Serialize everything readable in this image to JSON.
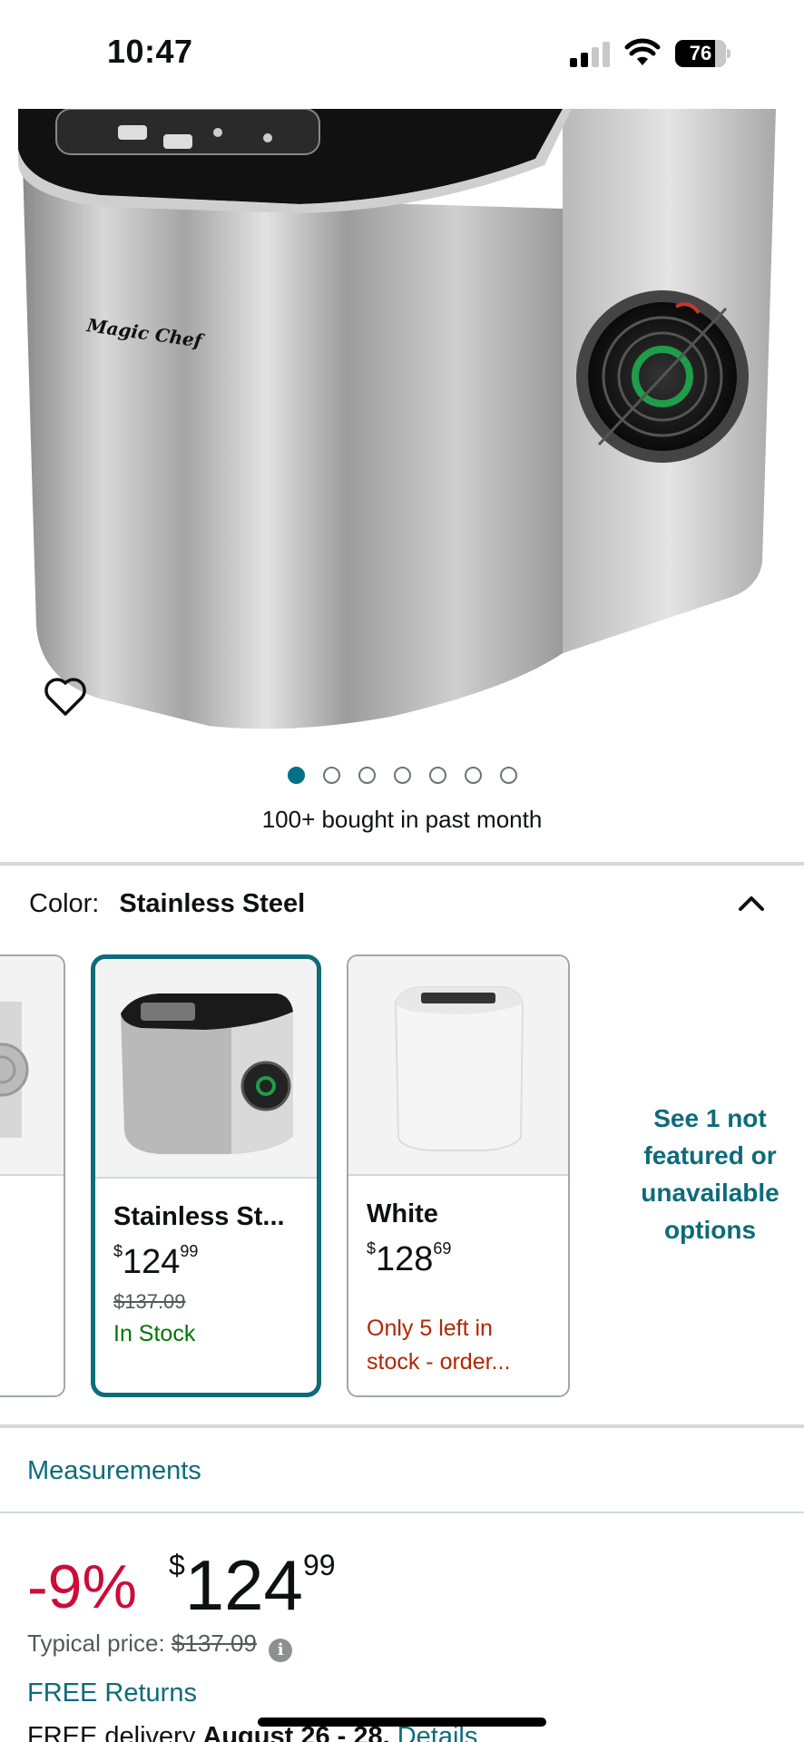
{
  "status_bar": {
    "time": "10:47",
    "battery": "76"
  },
  "product": {
    "brand_on_image": "Magic Chef",
    "bought_text": "100+ bought in past month",
    "carousel": {
      "total": 7,
      "active": 0
    }
  },
  "color": {
    "label": "Color:",
    "value": "Stainless Steel",
    "options": [
      {
        "name": "Stainless St...",
        "price_dollars": "124",
        "price_cents": "99",
        "list_price": "$137.09",
        "stock": "In Stock",
        "selected": true
      },
      {
        "name": "White",
        "price_dollars": "128",
        "price_cents": "69",
        "list_price": "",
        "stock": "Only 5 left in stock - order...",
        "selected": false
      }
    ],
    "see_more": "See 1 not featured or unavailable options"
  },
  "measurements_link": "Measurements",
  "price": {
    "discount": "-9%",
    "currency": "$",
    "dollars": "124",
    "cents": "99",
    "typical_label": "Typical price:",
    "typical_value": "$137.09"
  },
  "free_returns": "FREE Returns",
  "delivery": {
    "prefix": "FREE delivery",
    "dates": "August 26 - 28.",
    "details": "Details"
  },
  "colors": {
    "accent": "#007185",
    "deal_red": "#cc0c39",
    "in_stock": "#007600",
    "low_stock": "#b12704"
  }
}
